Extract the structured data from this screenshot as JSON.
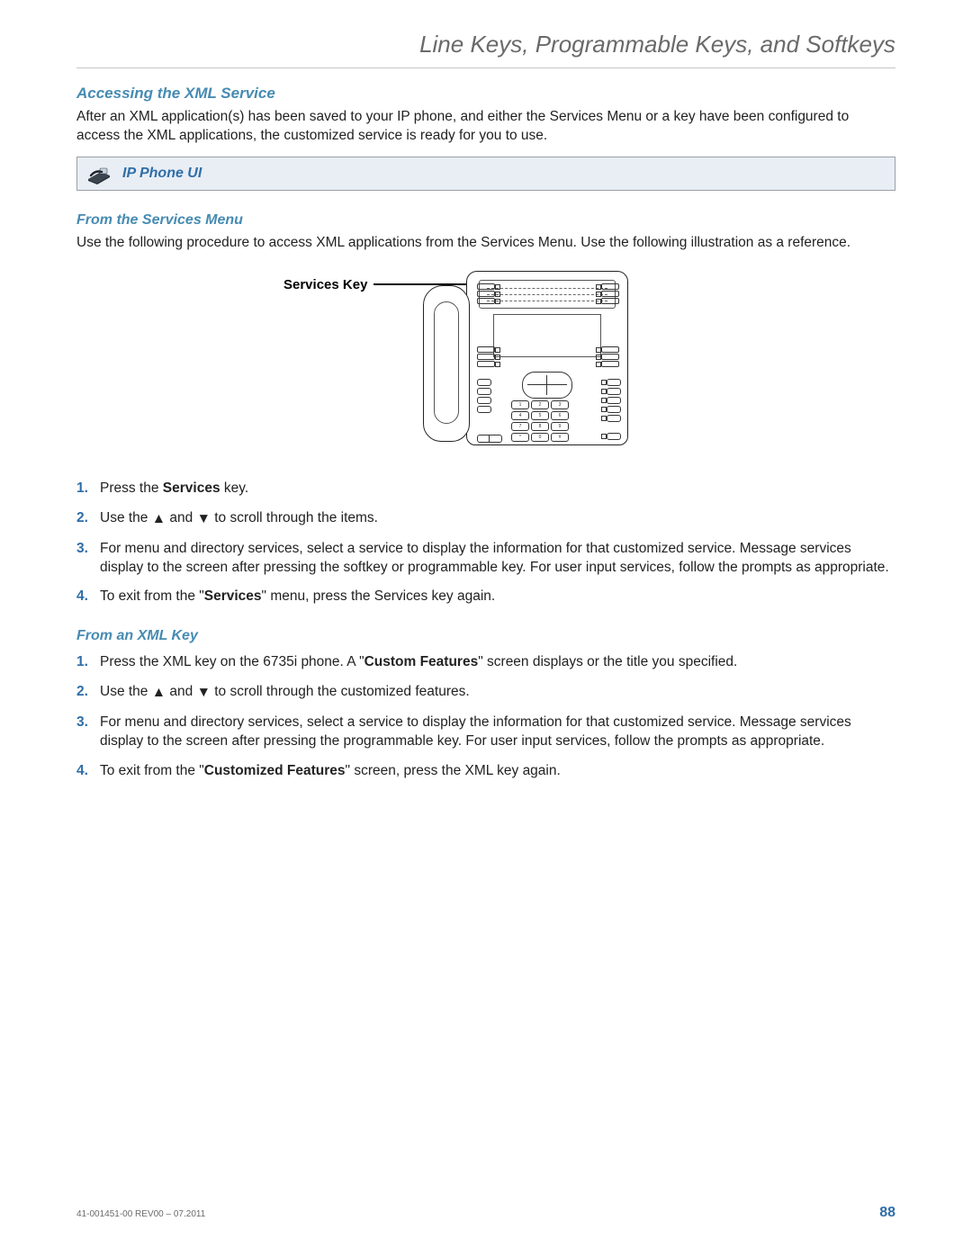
{
  "header": {
    "title": "Line Keys, Programmable Keys, and Softkeys"
  },
  "section": {
    "heading": "Accessing the XML Service"
  },
  "intro": "After an XML application(s) has been saved to your IP phone, and either the Services Menu or a key have been configured to access the XML applications, the customized service is ready for you to use.",
  "callout": {
    "icon_name": "ip-phone-icon",
    "label": "IP Phone UI"
  },
  "services_menu": {
    "heading": "From the Services Menu",
    "intro": "Use the following procedure to access XML applications from the Services Menu. Use the following illustration as a reference.",
    "figure_label": "Services Key",
    "steps": {
      "s1_a": "Press the ",
      "s1_b": "Services",
      "s1_c": " key.",
      "s2_a": "Use the ",
      "s2_b": " and ",
      "s2_c": " to scroll through the items.",
      "s3": "For menu and directory services, select a service to display the information for that customized service. Message services display to the screen after pressing the softkey or programmable key. For user input services, follow the prompts as appropriate.",
      "s4_a": "To exit from the \"",
      "s4_b": "Services",
      "s4_c": "\" menu, press the Services key again."
    }
  },
  "xml_key": {
    "heading": "From an XML Key",
    "steps": {
      "s1_a": "Press the XML key on the 6735i phone. A \"",
      "s1_b": "Custom Features",
      "s1_c": "\" screen displays or the title you specified.",
      "s2_a": "Use the ",
      "s2_b": " and ",
      "s2_c": " to scroll through the customized features.",
      "s3": "For menu and directory services, select a service to display the information for that customized service. Message services display to the screen after pressing the programmable key. For user input services, follow the prompts as appropriate.",
      "s4_a": "To exit from the \"",
      "s4_b": "Customized Features",
      "s4_c": "\" screen, press the XML key again."
    }
  },
  "glyphs": {
    "up": "▲",
    "down": "▼"
  },
  "footer": {
    "doc_id": "41-001451-00 REV00 – 07.2011",
    "page": "88"
  }
}
